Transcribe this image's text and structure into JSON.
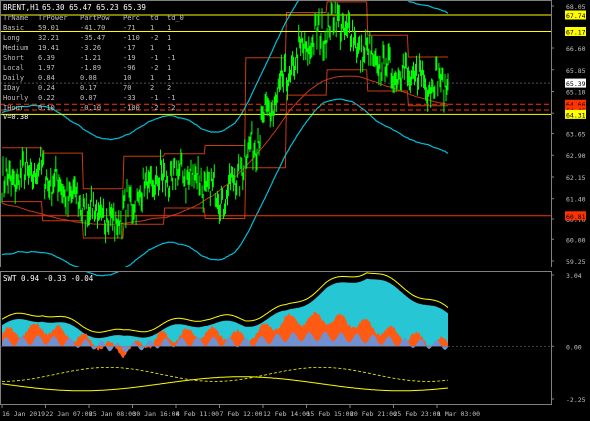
{
  "header": {
    "symbol": "BRENT,H1",
    "quote": "65.30 65.47 65.23 65.39"
  },
  "stats_table": {
    "columns": [
      "TrName",
      "TrPower",
      "PartPow",
      "Perc",
      "td",
      "td_0"
    ],
    "rows": [
      [
        "Basic",
        "59.01",
        "-41.70",
        "-71",
        "1",
        "1"
      ],
      [
        "Long",
        "32.21",
        "-35.47",
        "-110",
        "-2",
        "1"
      ],
      [
        "Medium",
        "19.41",
        "-3.26",
        "-17",
        "1",
        "1"
      ],
      [
        "Short",
        "6.39",
        "-1.21",
        "-19",
        "-1",
        "-1"
      ],
      [
        "Local",
        "1.97",
        "-1.89",
        "-96",
        "-2",
        "1"
      ],
      [
        "Daily",
        "0.84",
        "0.08",
        "10",
        "1",
        "1"
      ],
      [
        "IDay",
        "0.24",
        "0.17",
        "70",
        "2",
        "2"
      ],
      [
        "Hourly",
        "0.22",
        "0.07",
        "-33",
        "-1",
        "-1"
      ],
      [
        "IHour",
        "0.10",
        "-0.10",
        "-100",
        "-2",
        "-2"
      ]
    ],
    "footer": "V=0.38"
  },
  "price_axis": {
    "ticks": [
      "68.05",
      "66.60",
      "65.85",
      "65.10",
      "64.35",
      "63.65",
      "62.90",
      "62.15",
      "61.40",
      "60.70",
      "60.00",
      "59.25"
    ],
    "tags": [
      {
        "text": "67.74",
        "price": 67.74,
        "color": "#ffff00"
      },
      {
        "text": "67.17",
        "price": 67.17,
        "color": "#ffff00"
      },
      {
        "text": "65.39",
        "price": 65.39,
        "color": "#ffffff"
      },
      {
        "text": "64.66",
        "price": 64.66,
        "color": "#ff3300"
      },
      {
        "text": "64.46",
        "price": 64.46,
        "color": "#ff3300"
      },
      {
        "text": "64.31",
        "price": 64.31,
        "color": "#ffff00"
      },
      {
        "text": "60.81",
        "price": 60.81,
        "color": "#ff3300"
      }
    ]
  },
  "indicator": {
    "label": "SWT 0.94 -0.33 -0.04",
    "ticks": [
      "3.04",
      "0.00",
      "-2.25"
    ]
  },
  "time_axis": {
    "labels": [
      "16 Jan 2019",
      "22 Jan 07:00",
      "25 Jan 08:00",
      "30 Jan 16:00",
      "4 Feb 11:00",
      "7 Feb 12:00",
      "12 Feb 14:00",
      "15 Feb 15:00",
      "20 Feb 21:00",
      "25 Feb 23:00",
      "1 Mar 03:00"
    ]
  },
  "colors": {
    "price": "#00ff00",
    "cyan_band": "#00bfd8",
    "channel": "#c83a14",
    "level_red": "#ff3300",
    "level_yellow": "#ffff00",
    "grid": "#2a2a2a",
    "area_cyan": "#26c6d4",
    "area_orange": "#ff5a14",
    "area_blue": "#7090d0"
  },
  "chart_data": [
    {
      "type": "line",
      "title": "BRENT,H1",
      "ylim": [
        59.25,
        68.05
      ],
      "x": [
        "16 Jan 2019",
        "22 Jan 07:00",
        "25 Jan 08:00",
        "30 Jan 16:00",
        "4 Feb 11:00",
        "7 Feb 12:00",
        "12 Feb 14:00",
        "15 Feb 15:00",
        "20 Feb 21:00",
        "25 Feb 23:00",
        "1 Mar 03:00"
      ],
      "series": [
        {
          "values": [
            61.9,
            62.4,
            61.3,
            60.6,
            61.9,
            62.3,
            61.4,
            63.9,
            66.4,
            67.6,
            66.1,
            65.6,
            65.39
          ]
        }
      ],
      "horizontal_levels": [
        67.74,
        67.17,
        64.66,
        64.46,
        64.31,
        60.81
      ],
      "last_price": 65.39
    },
    {
      "type": "area",
      "title": "SWT 0.94 -0.33 -0.04",
      "ylim": [
        -2.25,
        3.04
      ],
      "series": [
        {
          "name": "",
          "values": [
            0.9,
            1.2,
            0.6,
            0.3,
            0.7,
            1.0,
            0.9,
            1.4,
            2.4,
            3.0,
            2.2,
            1.3
          ]
        },
        {
          "name": "",
          "values": [
            0.5,
            0.8,
            0.3,
            -0.2,
            0.4,
            0.6,
            0.4,
            1.1,
            1.2,
            0.9,
            0.4,
            0.1
          ]
        }
      ]
    }
  ]
}
